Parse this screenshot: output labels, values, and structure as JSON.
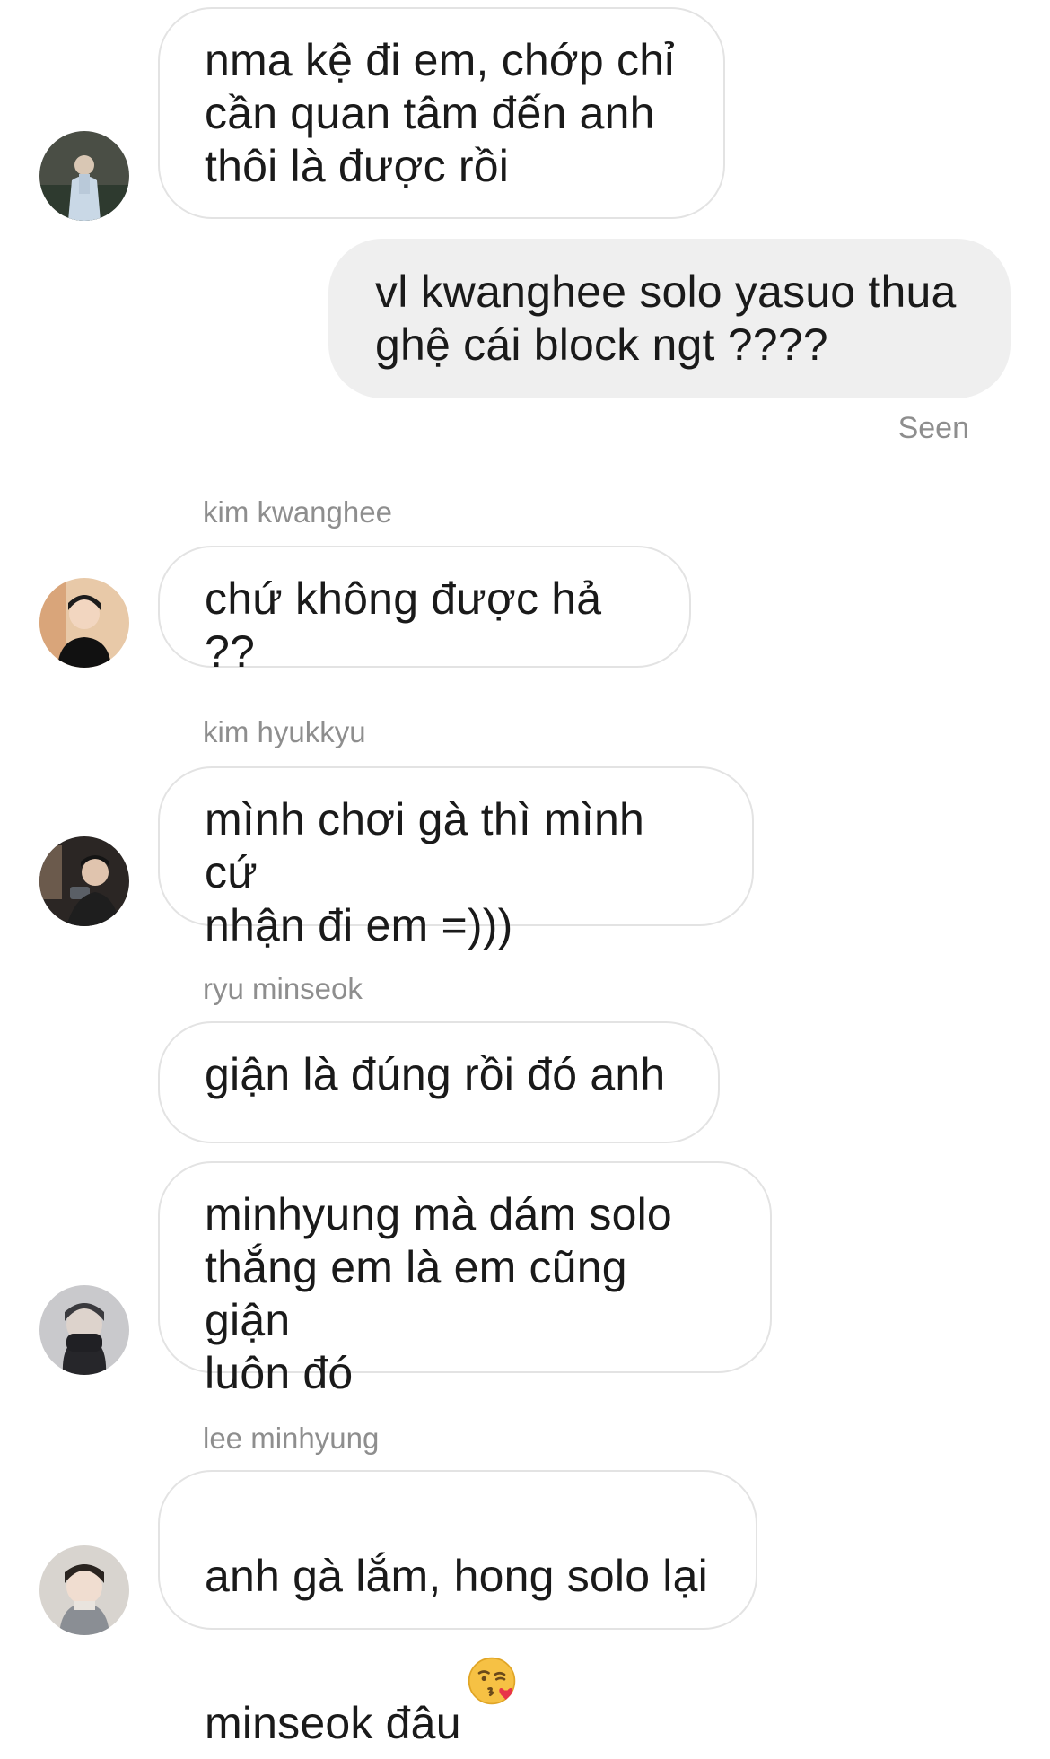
{
  "conversation": {
    "messages": [
      {
        "sender": "",
        "text": "nma kệ đi em, chớp chỉ\ncần quan tâm đến anh\nthôi là được rồi"
      },
      {
        "sender": "me",
        "text": "vl kwanghee solo yasuo thua\nghệ cái block ngt ????",
        "status": "Seen"
      },
      {
        "sender": "kim kwanghee",
        "text": "chứ không được hả ??"
      },
      {
        "sender": "kim hyukkyu",
        "text": "mình chơi gà thì mình cứ\nnhận đi em =)))"
      },
      {
        "sender": "ryu minseok",
        "text": "giận là đúng rồi đó anh"
      },
      {
        "sender": "ryu minseok",
        "text": "minhyung mà dám solo\nthắng em là em cũng giận\nluôn đó"
      },
      {
        "sender": "lee minhyung",
        "text": "anh gà lắm, hong solo lại\nminseok đâu",
        "emoji": "face-blowing-kiss-emoji"
      }
    ]
  },
  "colors": {
    "received_bubble_border": "#e3e3e3",
    "sent_bubble_bg": "#efefef",
    "meta_text": "#8e8e8e"
  },
  "icons": {
    "avatar": "profile-photo",
    "emoji": "face-blowing-kiss-emoji"
  }
}
